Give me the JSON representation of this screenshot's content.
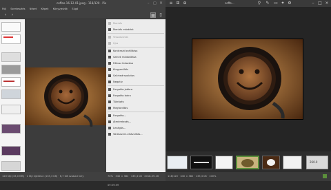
{
  "left_window": {
    "title": "coffee-16-12-01.jpeg - 118/120 - Pix",
    "menu": [
      "Fájl",
      "Szerkesztés",
      "Nézet",
      "Képek",
      "Könyvjelzők",
      "Súgó"
    ],
    "context_menu": [
      {
        "label": "Mentés",
        "disabled": true,
        "icon": "save-icon"
      },
      {
        "label": "Mentés másként",
        "disabled": false,
        "icon": "save-as-icon"
      },
      {
        "label": "Visszavonás",
        "disabled": true,
        "icon": "undo-icon"
      },
      {
        "label": "Újra",
        "disabled": true,
        "icon": "redo-icon"
      },
      {
        "label": "Kontraszt beállítása",
        "disabled": false,
        "icon": "contrast-icon"
      },
      {
        "label": "Színek módosítása",
        "disabled": false,
        "icon": "colors-icon"
      },
      {
        "label": "Fókusz fokozása",
        "disabled": false,
        "icon": "sharpen-icon"
      },
      {
        "label": "Kiegyenlítés",
        "disabled": false,
        "icon": "equalize-icon"
      },
      {
        "label": "Szürkeárnyalatos",
        "disabled": false,
        "icon": "grayscale-icon"
      },
      {
        "label": "Negatív",
        "disabled": false,
        "icon": "negative-icon"
      },
      {
        "label": "Forgatás jobbra",
        "disabled": false,
        "icon": "rotate-right-icon"
      },
      {
        "label": "Forgatás balra",
        "disabled": false,
        "icon": "rotate-left-icon"
      },
      {
        "label": "Tükrözés",
        "disabled": false,
        "icon": "mirror-icon"
      },
      {
        "label": "Megfordítás",
        "disabled": false,
        "icon": "flip-icon"
      },
      {
        "label": "Forgatás...",
        "disabled": false,
        "icon": "rotate-icon"
      },
      {
        "label": "Átméretezés...",
        "disabled": false,
        "icon": "resize-icon"
      },
      {
        "label": "Levágás...",
        "disabled": false,
        "icon": "crop-icon"
      },
      {
        "label": "Vörösszem-eltávolítás...",
        "disabled": false,
        "icon": "redeye-icon"
      }
    ],
    "status_left": "120 fájl (33,0 MB) · 1 fájl kijelölve (135,3 kB) · 6,7 GB szabad hely",
    "status_right": "70% · 340 × 382 · 135,3 kB · 2018-09-16 09:59:59"
  },
  "right_window": {
    "title": "coffe...",
    "status": "118/120 · 340 × 382 · 135,3 kB · 100%",
    "overlay_text": "260.0"
  },
  "colors": {
    "accent": "#5b8f3b",
    "menu_bg": "#ececec"
  }
}
